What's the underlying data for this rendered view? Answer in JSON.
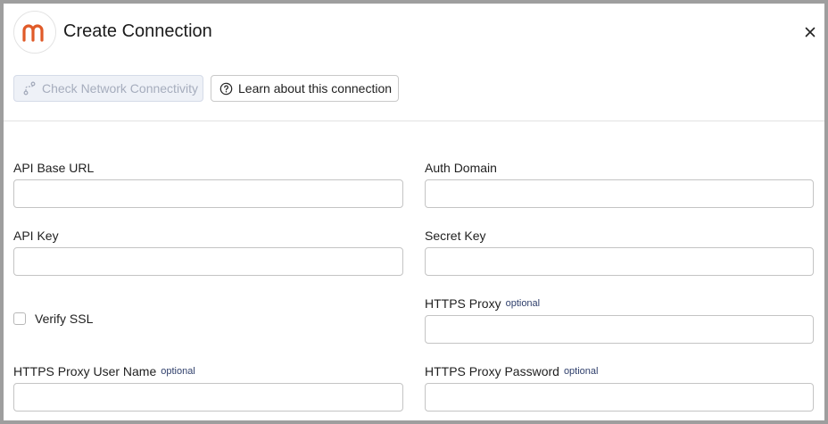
{
  "dialog": {
    "title": "Create Connection",
    "logo_letter": "m",
    "brand_color": "#e05a28"
  },
  "toolbar": {
    "check_network_label": "Check Network Connectivity",
    "learn_label": "Learn about this connection"
  },
  "form": {
    "optional_tag": "optional",
    "api_base_url": {
      "label": "API Base URL",
      "value": ""
    },
    "auth_domain": {
      "label": "Auth Domain",
      "value": ""
    },
    "api_key": {
      "label": "API Key",
      "value": ""
    },
    "secret_key": {
      "label": "Secret Key",
      "value": ""
    },
    "verify_ssl": {
      "label": "Verify SSL",
      "checked": false
    },
    "https_proxy": {
      "label": "HTTPS Proxy",
      "value": ""
    },
    "https_proxy_user": {
      "label": "HTTPS Proxy User Name",
      "value": ""
    },
    "https_proxy_password": {
      "label": "HTTPS Proxy Password",
      "value": ""
    }
  }
}
